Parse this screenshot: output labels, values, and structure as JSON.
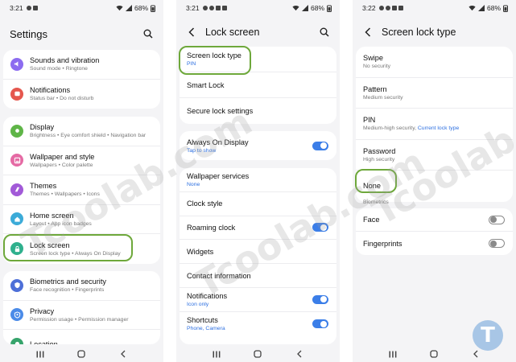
{
  "screens": [
    {
      "status": {
        "time": "3:21",
        "battery": "68%"
      },
      "title": "Settings",
      "cards": [
        {
          "items": [
            {
              "label": "Sounds and vibration",
              "sub": "Sound mode  •  Ringtone",
              "color": "#8c6cf0",
              "icon": "speaker-icon"
            },
            {
              "label": "Notifications",
              "sub": "Status bar  •  Do not disturb",
              "color": "#e5574e",
              "icon": "bell-icon"
            }
          ]
        },
        {
          "items": [
            {
              "label": "Display",
              "sub": "Brightness  •  Eye comfort shield  •  Navigation bar",
              "color": "#5fb548",
              "icon": "sun-icon"
            },
            {
              "label": "Wallpaper and style",
              "sub": "Wallpapers  •  Color palette",
              "color": "#e56aa4",
              "icon": "picture-icon"
            },
            {
              "label": "Themes",
              "sub": "Themes  •  Wallpapers  •  Icons",
              "color": "#a25ad8",
              "icon": "brush-icon"
            },
            {
              "label": "Home screen",
              "sub": "Layout  •  App icon badges",
              "color": "#3cabd8",
              "icon": "home-icon"
            },
            {
              "label": "Lock screen",
              "sub": "Screen lock type  •  Always On Display",
              "color": "#2fb08d",
              "icon": "lock-icon"
            }
          ]
        },
        {
          "items": [
            {
              "label": "Biometrics and security",
              "sub": "Face recognition  •  Fingerprints",
              "color": "#4d6fd8",
              "icon": "shield-icon"
            },
            {
              "label": "Privacy",
              "sub": "Permission usage  •  Permission manager",
              "color": "#4b8be8",
              "icon": "privacy-icon"
            },
            {
              "label": "Location",
              "sub": "",
              "color": "#36a36b",
              "icon": "location-icon"
            }
          ]
        }
      ]
    },
    {
      "status": {
        "time": "3:21",
        "battery": "68%"
      },
      "title": "Lock screen",
      "cards": [
        {
          "items": [
            {
              "label": "Screen lock type",
              "sub": "PIN"
            },
            {
              "label": "Smart Lock",
              "sub": ""
            },
            {
              "label": "Secure lock settings",
              "sub": ""
            }
          ]
        },
        {
          "items": [
            {
              "label": "Always On Display",
              "sub": "Tap to show",
              "toggle": "on"
            }
          ]
        },
        {
          "items": [
            {
              "label": "Wallpaper services",
              "sub": "None"
            },
            {
              "label": "Clock style",
              "sub": ""
            },
            {
              "label": "Roaming clock",
              "sub": "",
              "toggle": "on"
            },
            {
              "label": "Widgets",
              "sub": ""
            },
            {
              "label": "Contact information",
              "sub": ""
            },
            {
              "label": "Notifications",
              "sub": "Icon only",
              "toggle": "on"
            },
            {
              "label": "Shortcuts",
              "sub": "Phone, Camera",
              "toggle": "on"
            }
          ]
        }
      ]
    },
    {
      "status": {
        "time": "3:22",
        "battery": "68%"
      },
      "title": "Screen lock type",
      "options": [
        {
          "label": "Swipe",
          "sub": "No security"
        },
        {
          "label": "Pattern",
          "sub": "Medium security"
        },
        {
          "label": "PIN",
          "sub": "Medium-high security, ",
          "sub_link": "Current lock type"
        },
        {
          "label": "Password",
          "sub": "High security"
        },
        {
          "label": "None",
          "sub": ""
        }
      ],
      "biometrics_label": "Biometrics",
      "biometrics": [
        {
          "label": "Face",
          "toggle": "off"
        },
        {
          "label": "Fingerprints",
          "toggle": "off"
        }
      ]
    }
  ],
  "watermark": "Tcoolab.com",
  "logo_letter": "T",
  "colors": {
    "accent": "#3b7ee8",
    "highlight": "#6ea83b",
    "link": "#2c6fe0"
  }
}
